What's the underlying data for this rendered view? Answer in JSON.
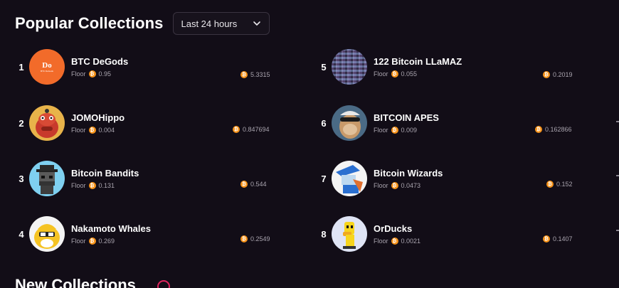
{
  "header": {
    "title": "Popular Collections",
    "timeframe": "Last 24 hours"
  },
  "collections": [
    {
      "rank": "1",
      "name": "BTC DeGods",
      "floor_label": "Floor",
      "floor": "0.95",
      "volume": "5.3315",
      "avatar_text": "Do",
      "avatar_sub": "BTC DeGods"
    },
    {
      "rank": "2",
      "name": "JOMOHippo",
      "floor_label": "Floor",
      "floor": "0.004",
      "volume": "0.847694"
    },
    {
      "rank": "3",
      "name": "Bitcoin Bandits",
      "floor_label": "Floor",
      "floor": "0.131",
      "volume": "0.544"
    },
    {
      "rank": "4",
      "name": "Nakamoto Whales",
      "floor_label": "Floor",
      "floor": "0.269",
      "volume": "0.2549"
    },
    {
      "rank": "5",
      "name": "122 Bitcoin LLaMAZ",
      "floor_label": "Floor",
      "floor": "0.055",
      "volume": "0.2019"
    },
    {
      "rank": "6",
      "name": "BITCOIN APES",
      "floor_label": "Floor",
      "floor": "0.009",
      "volume": "0.162866"
    },
    {
      "rank": "7",
      "name": "Bitcoin Wizards",
      "floor_label": "Floor",
      "floor": "0.0473",
      "volume": "0.152"
    },
    {
      "rank": "8",
      "name": "OrDucks",
      "floor_label": "Floor",
      "floor": "0.0021",
      "volume": "0.1407"
    }
  ],
  "new_section": {
    "title": "New Collections"
  },
  "icons": {
    "currency": "bitcoin-icon",
    "dropdown": "chevron-down-icon",
    "info": "info-icon"
  },
  "colors": {
    "background": "#120d17",
    "bitcoin": "#f7931a",
    "accent": "#e0245e"
  }
}
